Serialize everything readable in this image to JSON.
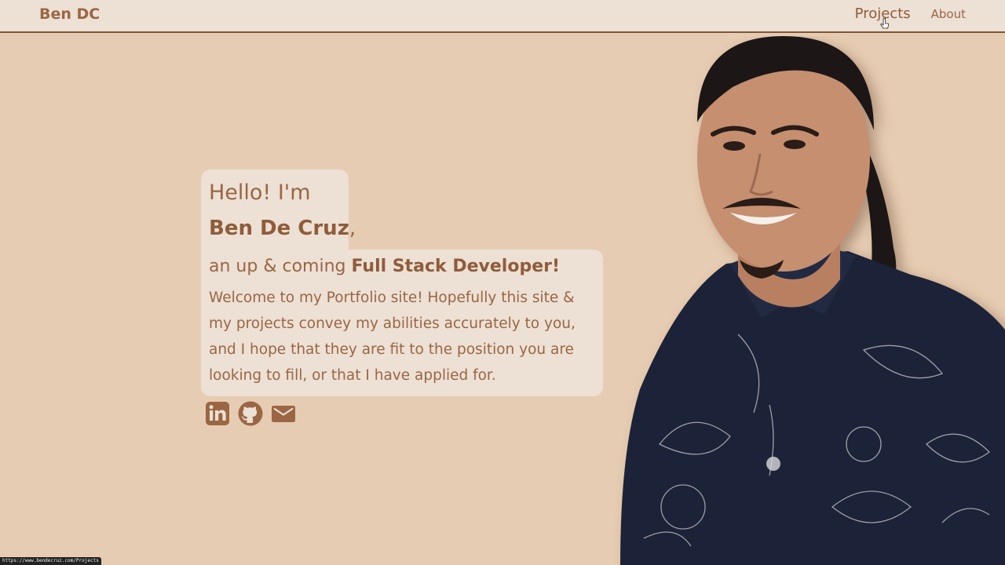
{
  "nav": {
    "brand": "Ben DC",
    "links": [
      {
        "label": "Projects",
        "active": true
      },
      {
        "label": "About",
        "active": false
      }
    ]
  },
  "intro": {
    "greeting": "Hello! I'm",
    "name": "Ben De Cruz",
    "name_suffix": ",",
    "role_prefix": "an up & coming ",
    "role": "Full Stack Developer!",
    "welcome": "Welcome to my Portfolio site! Hopefully this site & my projects convey my abilities accurately to you, and I hope that they are fit to the position you are looking to fill, or that I have applied for."
  },
  "socials": [
    {
      "icon": "linkedin-icon"
    },
    {
      "icon": "github-icon"
    },
    {
      "icon": "mail-icon"
    }
  ],
  "status_bar": {
    "url": "https://www.bendecruz.com/Projects"
  },
  "colors": {
    "background": "#e6ccb2",
    "panel": "#ede0d4",
    "accent": "#9a6644",
    "accent_dark": "#7f5539"
  }
}
